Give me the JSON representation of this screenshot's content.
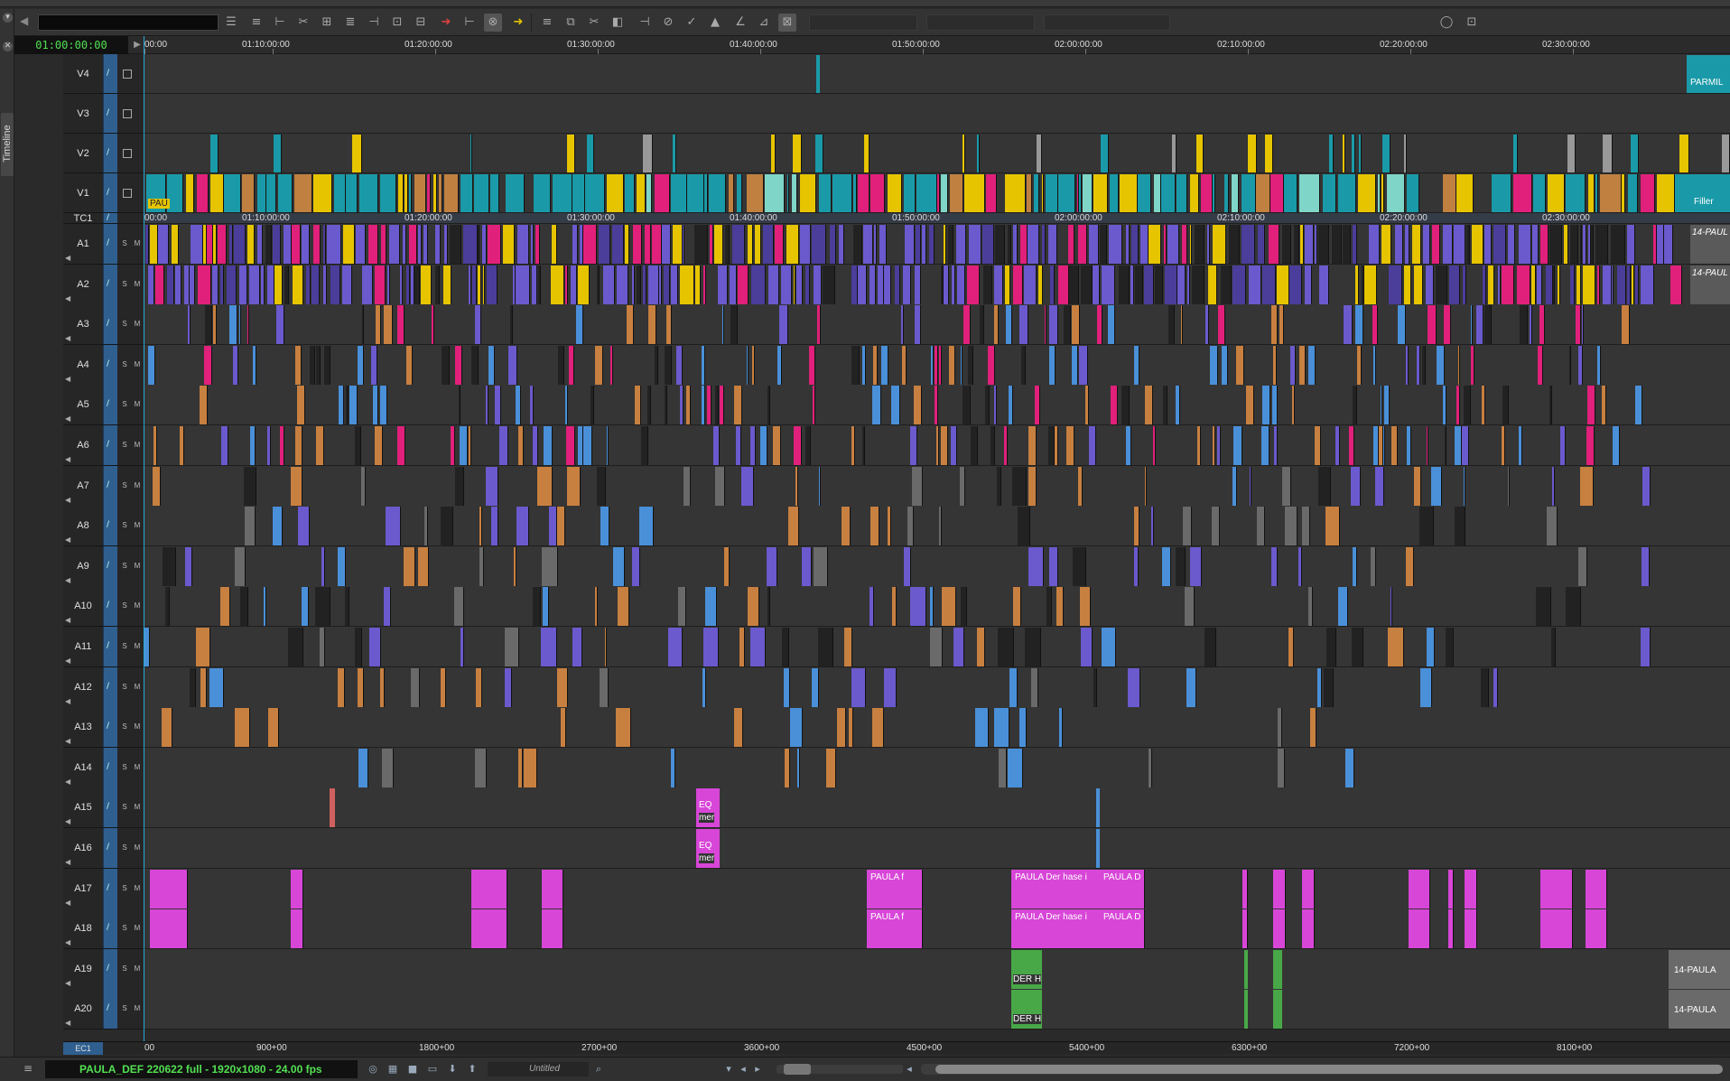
{
  "window": {
    "title": "Timeline"
  },
  "toolbar": {
    "master_timecode": "01:00:00:00"
  },
  "ruler": {
    "timecodes": [
      "00:00",
      "01:10:00:00",
      "01:20:00:00",
      "01:30:00:00",
      "01:40:00:00",
      "01:50:00:00",
      "02:00:00:00",
      "02:10:00:00",
      "02:20:00:00",
      "02:30:00:00"
    ],
    "tc1_labels": [
      "00:00",
      "01:10:00:00",
      "01:20:00:00",
      "01:30:00:00",
      "01:40:00:00",
      "01:50:00:00",
      "02:00:00:00",
      "02:10:00:00",
      "02:20:00:00",
      "02:30:00:00"
    ],
    "edgecodes": [
      "00",
      "900+00",
      "1800+00",
      "2700+00",
      "3600+00",
      "4500+00",
      "5400+00",
      "6300+00",
      "7200+00",
      "8100+00"
    ]
  },
  "tracks": {
    "video": [
      "V4",
      "V3",
      "V2",
      "V1"
    ],
    "timecode": "TC1",
    "audio": [
      "A1",
      "A2",
      "A3",
      "A4",
      "A5",
      "A6",
      "A7",
      "A8",
      "A9",
      "A10",
      "A11",
      "A12",
      "A13",
      "A14",
      "A15",
      "A16",
      "A17",
      "A18",
      "A19",
      "A20"
    ],
    "edgecode": "EC1",
    "solo_label": "S",
    "mute_label": "M"
  },
  "clip_labels": {
    "v4_end": "PARMIL",
    "v1_start": "PAU",
    "v1_end": "Filler",
    "a1_end": "14-PAUL",
    "a2_end": "14-PAUL",
    "a15_eq": "EQ",
    "a15_mer": "mer",
    "a16_eq": "EQ",
    "a16_mer": "mer",
    "a17_a": "PAULA f",
    "a17_b": "PAULA Der hase i",
    "a17_c": "PAULA D",
    "a18_a": "PAULA f",
    "a18_b": "PAULA Der hase i",
    "a18_c": "PAULA D",
    "a19_der": "DER H",
    "a19_end": "14-PAULA",
    "a20_der": "DER H",
    "a20_end": "14-PAULA"
  },
  "status": {
    "sequence_name": "PAULA_DEF 220622 full - 1920x1080 - 24.00 fps",
    "bin": "Untitled"
  },
  "colors": {
    "teal": "#1a9aa8",
    "purple": "#6a5acd",
    "blue": "#4a90d9",
    "orange": "#c88040",
    "magenta": "#d846d8",
    "yellow": "#e6c400",
    "pink": "#e0207a",
    "green": "#48a848",
    "gray": "#6a6a6a",
    "timecode_green": "#52e052"
  }
}
